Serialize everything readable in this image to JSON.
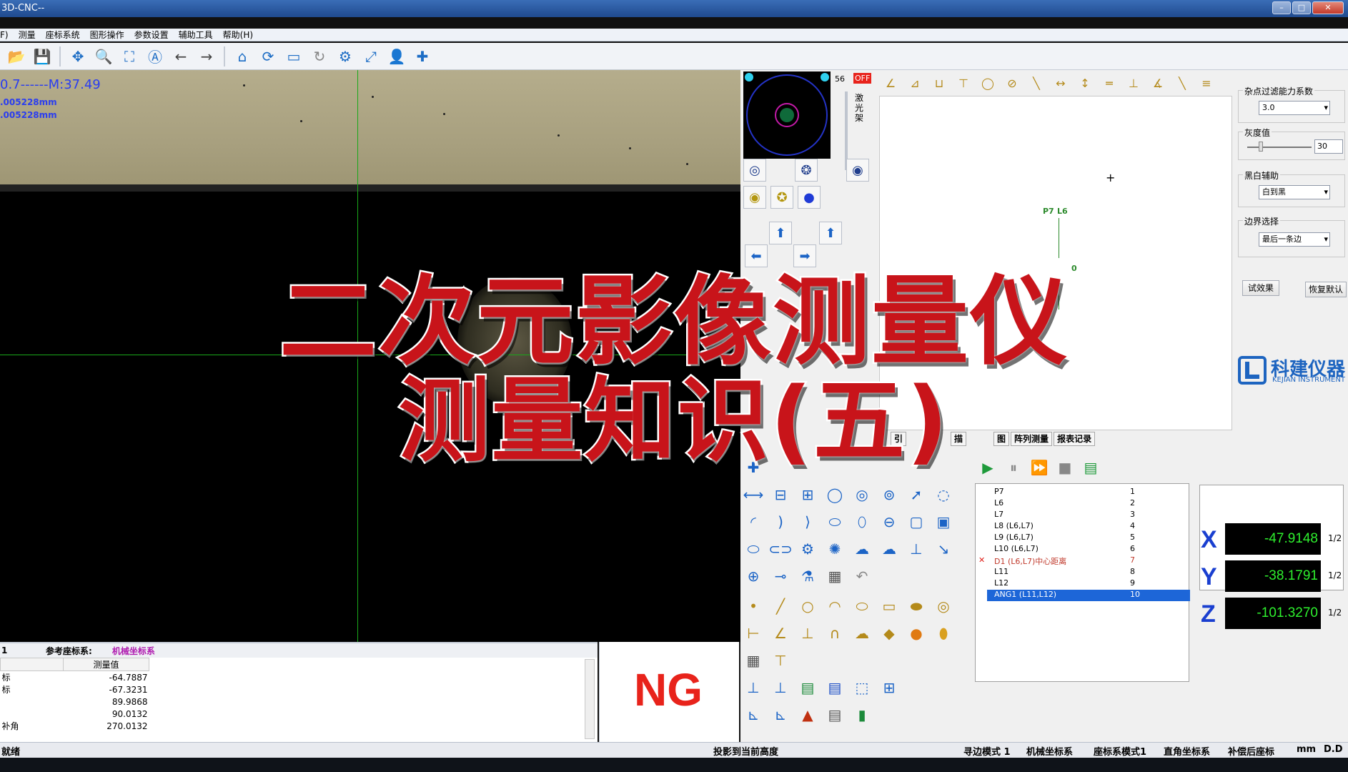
{
  "window": {
    "title": "3D-CNC--",
    "min": "–",
    "max": "□",
    "close": "✕"
  },
  "menu": [
    "F)",
    "测量",
    "座标系统",
    "图形操作",
    "参数设置",
    "辅助工具",
    "帮助(H)"
  ],
  "camera": {
    "readout1": "0.7------M:37.49",
    "readout2": ".005228mm",
    "readout3": ".005228mm"
  },
  "results": {
    "ref_label": "参考座标系:",
    "ref_value": "机械坐标系",
    "row_no": "1",
    "col_value": "测量值",
    "rows": [
      {
        "name": "标",
        "value": "-64.7887"
      },
      {
        "name": "标",
        "value": "-67.3231"
      },
      {
        "name": "",
        "value": "89.9868"
      },
      {
        "name": "",
        "value": "90.0132"
      },
      {
        "name": "补角",
        "value": "270.0132"
      }
    ],
    "status_text": "NG"
  },
  "camera_panel": {
    "light_value": "56",
    "off_label": "OFF",
    "laser_label": "激光架"
  },
  "graphic": {
    "label_p7": "P7",
    "label_l6": "L6",
    "label_zero": "0"
  },
  "params": {
    "filter_label": "杂点过滤能力系数",
    "filter_value": "3.0",
    "gray_label": "灰度值",
    "gray_value": "30",
    "bw_label": "黑白辅助",
    "bw_value": "白到黑",
    "edge_label": "边界选择",
    "edge_value": "最后一条边",
    "try_button": "试效果",
    "reset_button": "恢复默认"
  },
  "brand": {
    "name": "科建仪器",
    "sub": "KEJIAN INSTRUMENT"
  },
  "tabs": [
    "引",
    "描",
    "图",
    "阵列测量",
    "报表记录"
  ],
  "elements": [
    {
      "label": "P7",
      "no": "1",
      "selected": false,
      "error": false
    },
    {
      "label": "L6",
      "no": "2",
      "selected": false,
      "error": false
    },
    {
      "label": "L7",
      "no": "3",
      "selected": false,
      "error": false
    },
    {
      "label": "L8 (L6,L7)",
      "no": "4",
      "selected": false,
      "error": false
    },
    {
      "label": "L9 (L6,L7)",
      "no": "5",
      "selected": false,
      "error": false
    },
    {
      "label": "L10 (L6,L7)",
      "no": "6",
      "selected": false,
      "error": false
    },
    {
      "label": "D1 (L6,L7)中心距离",
      "no": "7",
      "selected": false,
      "error": true
    },
    {
      "label": "L11",
      "no": "8",
      "selected": false,
      "error": false
    },
    {
      "label": "L12",
      "no": "9",
      "selected": false,
      "error": false
    },
    {
      "label": "ANG1 (L11,L12)",
      "no": "10",
      "selected": true,
      "error": false
    }
  ],
  "coords": [
    {
      "axis": "X",
      "value": "-47.9148",
      "half": "1/2"
    },
    {
      "axis": "Y",
      "value": "-38.1791",
      "half": "1/2"
    },
    {
      "axis": "Z",
      "value": "-101.3270",
      "half": "1/2"
    }
  ],
  "status": {
    "ready": "就绪",
    "project": "投影到当前高度",
    "edge_mode": "寻边模式 1",
    "machine": "机械坐标系",
    "coord_mode": "座标系模式1",
    "rect": "直角坐标系",
    "comp": "补偿后座标",
    "unit": "mm",
    "dd": "D.D"
  },
  "overlay": {
    "line1": "二次元影像测量仪",
    "line2": "测量知识(五)"
  },
  "colors": {
    "accent": "#1c64c6",
    "ng": "#e8231b",
    "overlay": "#c8141a",
    "coord_text": "#2ef02e"
  }
}
